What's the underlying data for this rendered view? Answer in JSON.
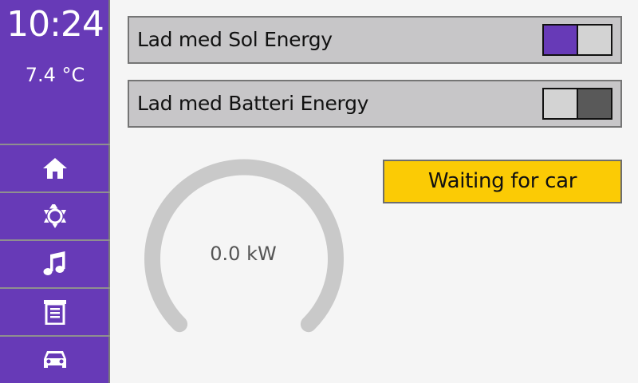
{
  "status_bar": {
    "time": "10:24",
    "temperature": "7.4 °C"
  },
  "nav": {
    "items": [
      {
        "icon": "home-icon"
      },
      {
        "icon": "brightness-icon"
      },
      {
        "icon": "music-note-icon"
      },
      {
        "icon": "list-document-icon"
      },
      {
        "icon": "car-icon"
      }
    ]
  },
  "toggles": [
    {
      "label": "Lad med Sol Energy",
      "state": "on"
    },
    {
      "label": "Lad med Batteri Energy",
      "state": "off"
    }
  ],
  "charger": {
    "status": "Waiting for car",
    "power": "0.0 kW",
    "power_value": 0.0
  },
  "colors": {
    "accent": "#673AB7",
    "status_yellow": "#FBCB05",
    "gauge_track": "#C9C9C9",
    "toggle_off_dark": "#595959"
  }
}
